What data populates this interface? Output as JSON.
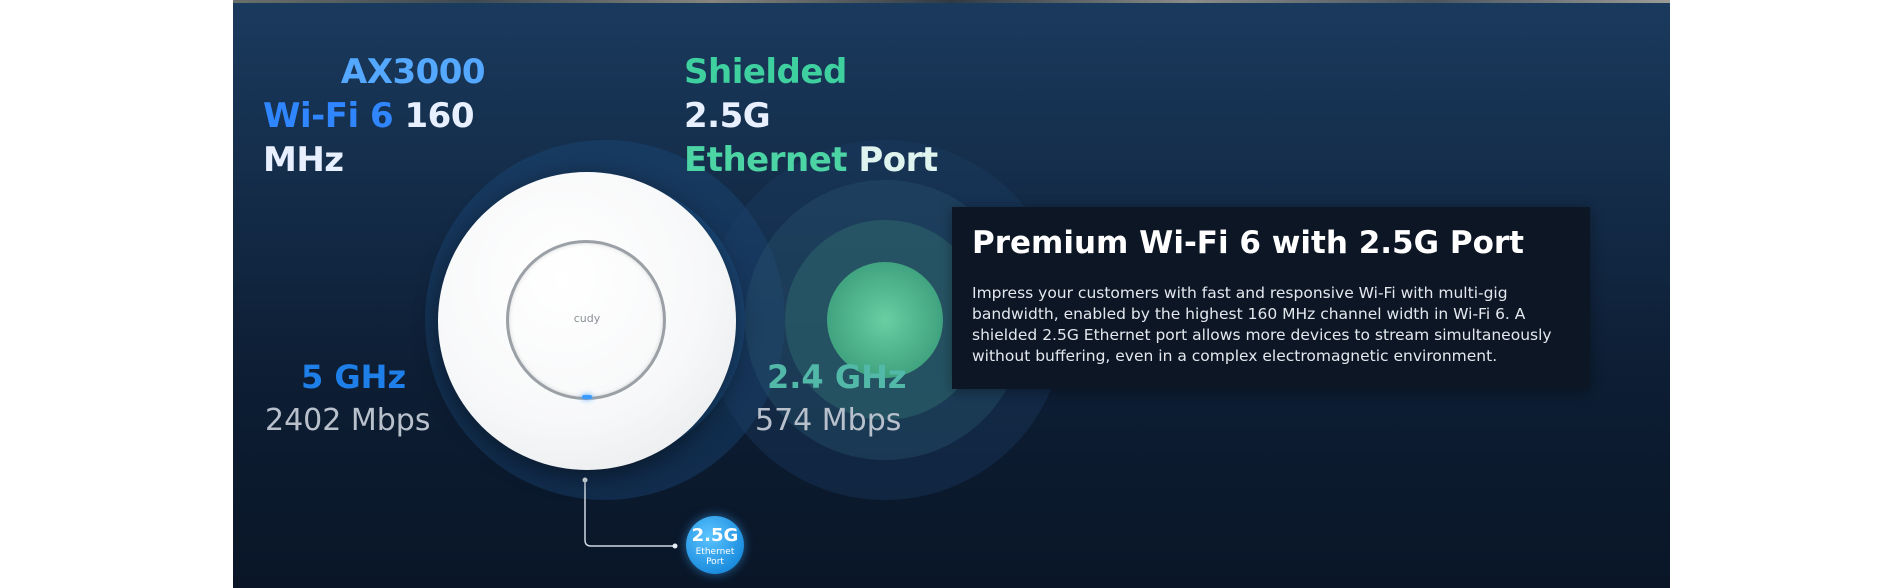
{
  "headings": {
    "wifi_line1": "AX3000",
    "wifi_line2_a": "Wi-Fi 6",
    "wifi_line2_b": "160 MHz",
    "eth_line1_a": "Shielded",
    "eth_line1_b": "2.5G",
    "eth_line2_a": "Ethernet",
    "eth_line2_b": "Port"
  },
  "bands": [
    {
      "label": "5 GHz",
      "speed": "2402 Mbps"
    },
    {
      "label": "2.4 GHz",
      "speed": "574 Mbps"
    }
  ],
  "device": {
    "logo": "cudy"
  },
  "port_badge": {
    "speed": "2.5G",
    "line1": "Ethernet",
    "line2": "Port"
  },
  "card": {
    "title": "Premium Wi-Fi 6 with 2.5G Port",
    "body": "Impress your customers with fast and responsive Wi-Fi with multi-gig bandwidth, enabled by the highest 160 MHz channel width in Wi-Fi 6. A shielded 2.5G Ethernet port allows more devices to stream simultaneously without buffering, even in a complex electromagnetic environment."
  },
  "colors": {
    "blue_signal": "#2f86ff",
    "green_signal": "#3fd0a0",
    "background_top": "#1a3a5e",
    "background_bottom": "#0a1628"
  }
}
